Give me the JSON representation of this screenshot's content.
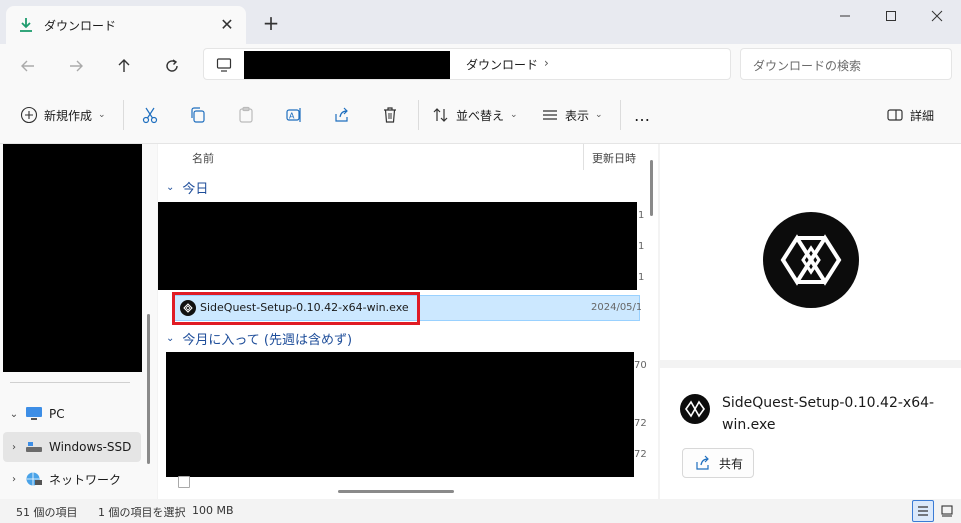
{
  "tab": {
    "title": "ダウンロード",
    "close": "✕",
    "new_tab": "+"
  },
  "address": {
    "crumb": "ダウンロード",
    "crumb_chevron": "›"
  },
  "search": {
    "placeholder": "ダウンロードの検索"
  },
  "toolbar": {
    "new_label": "新規作成",
    "sort_label": "並べ替え",
    "view_label": "表示",
    "more_label": "…",
    "details_label": "詳細",
    "dropdown": "⌄"
  },
  "nav": {
    "pc_label": "PC",
    "drive_label": "Windows-SSD",
    "network_label": "ネットワーク",
    "chev_open": "⌄",
    "chev_closed": "›"
  },
  "list": {
    "col_name": "名前",
    "col_date": "更新日時",
    "group_today": "今日",
    "group_month": "今月に入って (先週は含めず)",
    "group_chevron": "⌄",
    "edge_dates": [
      "1",
      "1",
      "1",
      "70",
      "72",
      "72"
    ],
    "selected_file": {
      "name": "SideQuest-Setup-0.10.42-x64-win.exe",
      "date": "2024/05/1"
    }
  },
  "details": {
    "file_name": "SideQuest-Setup-0.10.42-x64-win.exe",
    "share_label": "共有"
  },
  "status": {
    "count": "51 個の項目",
    "selected": "1 個の項目を選択",
    "size": "100 MB"
  },
  "colors": {
    "accent": "#0067c0",
    "selection": "#cce8ff",
    "highlight_border": "#e01b24",
    "group_text": "#1f4e9a"
  }
}
